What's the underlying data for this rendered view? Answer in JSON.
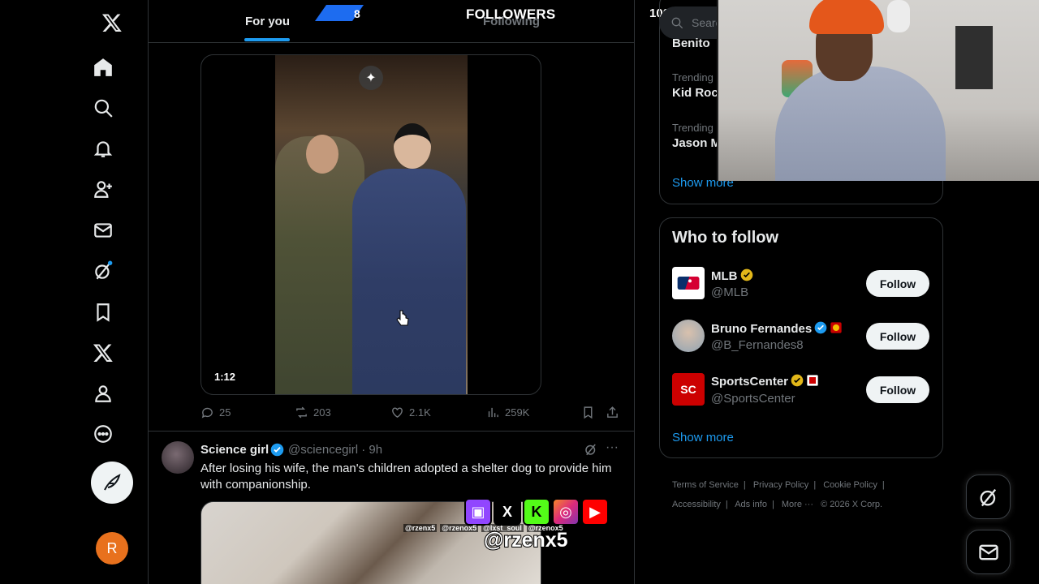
{
  "nav": {
    "items": [
      {
        "name": "x-logo-icon"
      },
      {
        "name": "home-icon"
      },
      {
        "name": "explore-icon"
      },
      {
        "name": "notifications-icon"
      },
      {
        "name": "follow-icon"
      },
      {
        "name": "messages-icon"
      },
      {
        "name": "grok-icon"
      },
      {
        "name": "bookmarks-icon"
      },
      {
        "name": "premium-icon"
      },
      {
        "name": "profile-icon"
      },
      {
        "name": "more-icon"
      }
    ],
    "post_icon": "feather-icon",
    "avatar_letter": "R"
  },
  "header": {
    "tabs": [
      {
        "label": "For you",
        "active": true
      },
      {
        "label": "Following",
        "active": false
      }
    ],
    "accent": "#1d9bf0"
  },
  "stream_overlay": {
    "followers_count": "8",
    "followers_label": "FOLLOWERS",
    "followers_goal": "100",
    "socials": [
      "twitch",
      "x",
      "kick",
      "instagram",
      "youtube"
    ],
    "small_handles": [
      "@rzenx5",
      "@rzenox5",
      "@lxst_soul",
      "@rzenox5"
    ],
    "main_handle": "@rzenx5"
  },
  "video_tweet": {
    "duration": "1:12",
    "replies": "25",
    "reposts": "203",
    "likes": "2.1K",
    "views": "259K"
  },
  "tweet2": {
    "name": "Science girl",
    "handle": "@sciencegirl · 9h",
    "text": "After losing his wife, the man's children adopted a shelter dog to provide him with companionship."
  },
  "search": {
    "placeholder": "Search"
  },
  "trends": {
    "items": [
      {
        "category": "",
        "name": "Benito"
      },
      {
        "category": "Trending",
        "name": "Kid Roc"
      },
      {
        "category": "Trending",
        "name": "Jason M"
      }
    ],
    "show_more": "Show more"
  },
  "who_to_follow": {
    "title": "Who to follow",
    "accounts": [
      {
        "name": "MLB",
        "handle": "@MLB",
        "badge": "gold",
        "button": "Follow"
      },
      {
        "name": "Bruno Fernandes",
        "handle": "@B_Fernandes8",
        "badge": "blue",
        "button": "Follow"
      },
      {
        "name": "SportsCenter",
        "handle": "@SportsCenter",
        "badge": "gold",
        "button": "Follow"
      }
    ],
    "show_more": "Show more"
  },
  "footer": {
    "links": [
      "Terms of Service",
      "|",
      "Privacy Policy",
      "|",
      "Cookie Policy",
      "|",
      "Accessibility",
      "|",
      "Ads info",
      "|",
      "More ···",
      "© 2026 X Corp."
    ]
  }
}
